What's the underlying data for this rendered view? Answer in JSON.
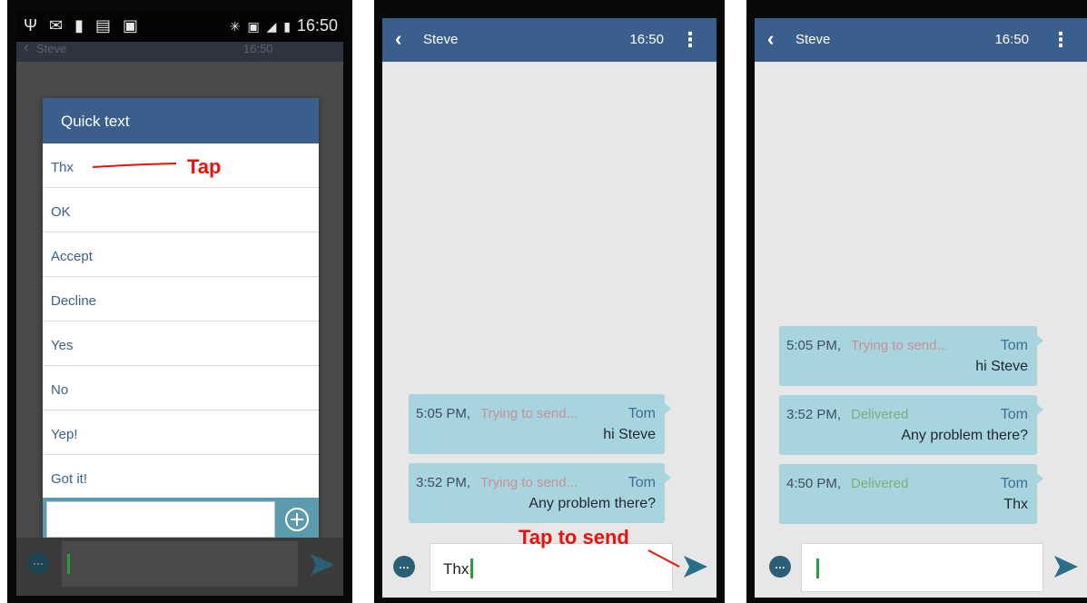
{
  "status_bar": {
    "left_icons": "Ψ ✉ ▮ ▤ ▣",
    "right_icons": "✳ ▣ ◢ ▮",
    "time": "16:50"
  },
  "dimmed_header": {
    "name": "Steve",
    "time": "16:50"
  },
  "quick_text": {
    "title": "Quick text",
    "items": [
      "Thx",
      "OK",
      "Accept",
      "Decline",
      "Yes",
      "No",
      "Yep!",
      "Got it!"
    ]
  },
  "annotations": {
    "tap": "Tap",
    "tap_to_send": "Tap to send"
  },
  "conversation": {
    "name": "Steve",
    "time": "16:50"
  },
  "screen2": {
    "messages": [
      {
        "time": "5:05 PM,",
        "status": "Trying to send...",
        "from": "Tom",
        "text": "hi Steve"
      },
      {
        "time": "3:52 PM,",
        "status": "Trying to send...",
        "from": "Tom",
        "text": "Any problem there?"
      }
    ],
    "input_text": "Thx"
  },
  "screen3": {
    "messages": [
      {
        "time": "5:05 PM,",
        "status": "Trying to send...",
        "from": "Tom",
        "text": "hi Steve"
      },
      {
        "time": "3:52 PM,",
        "status": "Delivered",
        "from": "Tom",
        "text": "Any problem there?"
      },
      {
        "time": "4:50 PM,",
        "status": "Delivered",
        "from": "Tom",
        "text": "Thx"
      }
    ],
    "input_text": ""
  },
  "colors": {
    "header": "#3a5f8c",
    "bubble": "#a8d4de",
    "pending": "#c79097",
    "delivered": "#7ab07e",
    "annotation": "#e8120c"
  },
  "icons": [
    "back-icon",
    "kebab-menu-icon",
    "chat-icon",
    "send-icon",
    "add-circle-icon"
  ]
}
